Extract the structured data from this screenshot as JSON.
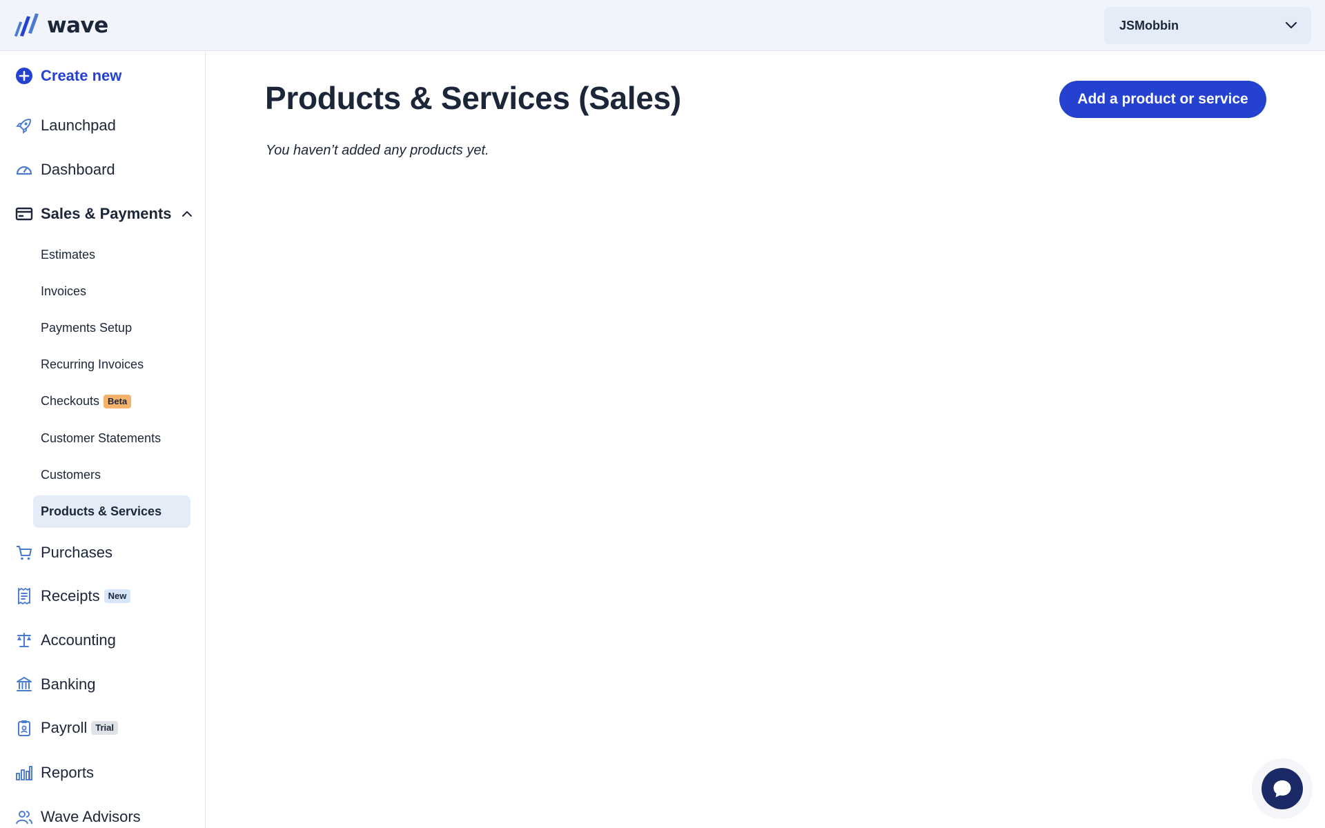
{
  "header": {
    "logo_text": "wave",
    "business_name": "JSMobbin"
  },
  "sidebar": {
    "create_new": "Create new",
    "items": [
      {
        "label": "Launchpad",
        "icon": "rocket-icon"
      },
      {
        "label": "Dashboard",
        "icon": "gauge-icon"
      },
      {
        "label": "Sales & Payments",
        "icon": "card-icon"
      },
      {
        "label": "Purchases",
        "icon": "cart-icon"
      },
      {
        "label": "Receipts",
        "icon": "receipt-icon",
        "badge": "New"
      },
      {
        "label": "Accounting",
        "icon": "scales-icon"
      },
      {
        "label": "Banking",
        "icon": "bank-icon"
      },
      {
        "label": "Payroll",
        "icon": "clipboard-icon",
        "badge": "Trial"
      },
      {
        "label": "Reports",
        "icon": "bar-chart-icon"
      },
      {
        "label": "Wave Advisors",
        "icon": "people-icon"
      }
    ],
    "sales_subitems": [
      {
        "label": "Estimates"
      },
      {
        "label": "Invoices"
      },
      {
        "label": "Payments Setup"
      },
      {
        "label": "Recurring Invoices"
      },
      {
        "label": "Checkouts",
        "badge": "Beta"
      },
      {
        "label": "Customer Statements"
      },
      {
        "label": "Customers"
      },
      {
        "label": "Products & Services",
        "active": true
      }
    ]
  },
  "main": {
    "title": "Products & Services (Sales)",
    "empty_message": "You haven’t added any products yet.",
    "add_button": "Add a product or service"
  },
  "colors": {
    "accent": "#2541cf",
    "text": "#1c2639",
    "header_bg": "#f1f5fb",
    "active_bg": "#e4ecf7",
    "icon_blue": "#4a7bd1"
  }
}
